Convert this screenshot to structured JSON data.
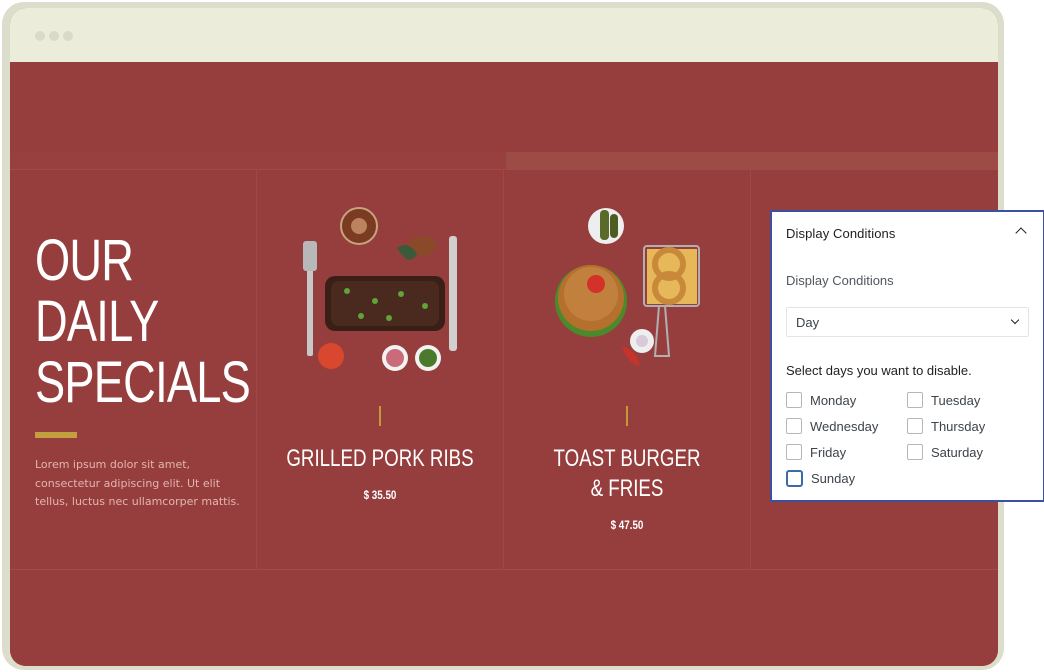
{
  "window": {
    "title_dots": 3
  },
  "hero": {
    "headline": "OUR\nDAILY\nSPECIALS",
    "intro": "Lorem ipsum dolor sit amet, consectetur adipiscing elit. Ut elit tellus, luctus nec ullamcorper mattis."
  },
  "dishes": [
    {
      "name": "GRILLED PORK RIBS",
      "price": "$ 35.50",
      "image": "grilled-pork-ribs-photo"
    },
    {
      "name": "TOAST BURGER & FRIES",
      "price": "$ 47.50",
      "image": "burger-and-fries-photo"
    }
  ],
  "panel": {
    "title": "Display Conditions",
    "field_label": "Display Conditions",
    "select_value": "Day",
    "help_text": "Select days you want to disable.",
    "days": [
      {
        "label": "Monday",
        "checked": false
      },
      {
        "label": "Tuesday",
        "checked": false
      },
      {
        "label": "Wednesday",
        "checked": false
      },
      {
        "label": "Thursday",
        "checked": false
      },
      {
        "label": "Friday",
        "checked": false
      },
      {
        "label": "Saturday",
        "checked": false
      },
      {
        "label": "Sunday",
        "checked": false,
        "focused": true
      }
    ]
  },
  "colors": {
    "brand_red": "#963e3e",
    "accent_gold": "#c3a03f",
    "panel_border": "#3b4fa4",
    "titlebar": "#ebecd9"
  }
}
